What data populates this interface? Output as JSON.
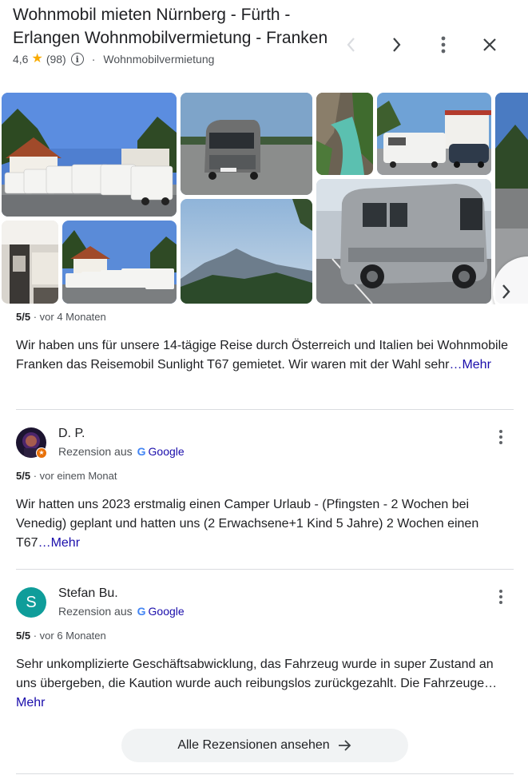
{
  "header": {
    "title": "Wohnmobil mieten Nürnberg - Fürth - Erlangen Wohnmobilvermietung - Franken",
    "rating": "4,6",
    "review_count": "(98)",
    "separator": "·",
    "category": "Wohnmobilvermietung"
  },
  "controls": {
    "prev_icon": "chevron-left-icon",
    "next_icon": "chevron-right-icon",
    "more_icon": "more-vert-icon",
    "close_icon": "close-icon"
  },
  "gallery": {
    "photos": [
      "motorhome-fleet",
      "camper-van-parking-lot",
      "turquoise-river-gorge",
      "motorhomes-at-dealer",
      "camper-interior",
      "motorhome-fleet-street",
      "mountain-landscape",
      "poessl-camper-van"
    ],
    "next_icon": "chevron-right-icon"
  },
  "reviews": [
    {
      "score": "5/5",
      "time": "· vor 4 Monaten",
      "text": "Wir haben uns für unsere 14-tägige Reise durch Österreich und Italien bei Wohnmobile Franken das Reisemobil Sunlight T67 gemietet. Wir waren mit der Wahl sehr",
      "more": "…Mehr"
    },
    {
      "author": "D. P.",
      "source_prefix": "Rezension aus",
      "source_name": "Google",
      "score": "5/5",
      "time": "· vor einem Monat",
      "text": "Wir hatten uns 2023 erstmalig einen Camper Urlaub - (Pfingsten - 2 Wochen bei Venedig) geplant und hatten uns (2 Erwachsene+1 Kind 5 Jahre) 2 Wochen einen T67",
      "more": "…Mehr"
    },
    {
      "author": "Stefan Bu.",
      "avatar_letter": "S",
      "source_prefix": "Rezension aus",
      "source_name": "Google",
      "score": "5/5",
      "time": "· vor 6 Monaten",
      "text": "Sehr unkomplizierte Geschäftsabwicklung, das Fahrzeug wurde in super Zustand an uns übergeben, die Kaution wurde auch reibungslos zurückgezahlt. Die Fahrzeuge…",
      "more": "Mehr"
    }
  ],
  "footer": {
    "all_reviews_label": "Alle Rezensionen ansehen"
  },
  "colors": {
    "link": "#1a0dab",
    "star": "#f9ab00",
    "avatar_s": "#0f9d9a",
    "local_guide_badge": "#e8710a",
    "button_bg": "#f1f3f4"
  }
}
